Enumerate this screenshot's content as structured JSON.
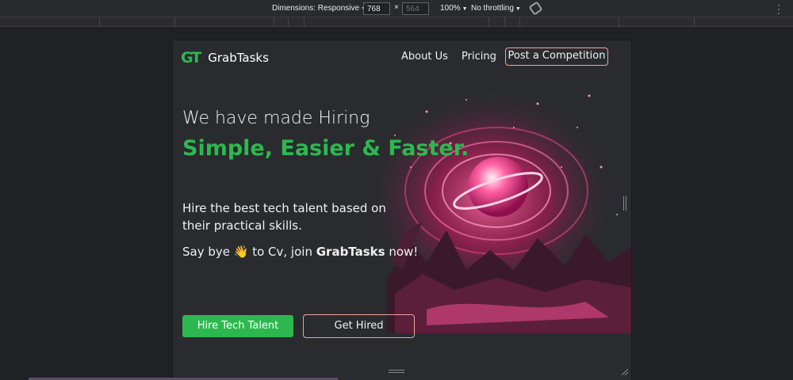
{
  "devtools": {
    "dimensions_label": "Dimensions: Responsive",
    "width_value": "768",
    "dim_separator": "×",
    "height_placeholder": "564",
    "zoom_label": "100%",
    "throttle_label": "No throttling",
    "icons": [
      "rotate-icon",
      "more-options-icon"
    ]
  },
  "nav": {
    "logo_mark": "GT",
    "brand": "GrabTasks",
    "links": [
      "About Us",
      "Pricing"
    ],
    "cta": "Post a Competition"
  },
  "hero": {
    "line1": "We have made Hiring",
    "line2": "Simple, Easier & Faster.",
    "description": "Hire the best tech talent based on their practical skills.",
    "bye_prefix": "Say bye ",
    "bye_emoji": "👋",
    "bye_mid": " to Cv, join ",
    "bye_brand": "GrabTasks",
    "bye_suffix": " now!"
  },
  "buttons": {
    "primary": "Hire Tech Talent",
    "secondary": "Get Hired"
  },
  "colors": {
    "accent_green": "#2db84f",
    "accent_pink": "#f1a0a4",
    "page_bg": "#2a2b2f"
  }
}
